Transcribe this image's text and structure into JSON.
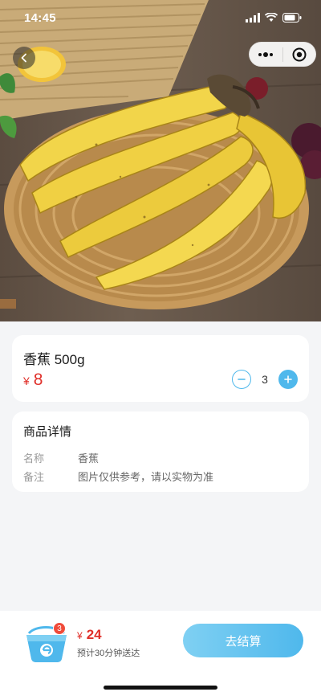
{
  "status_bar": {
    "time": "14:45"
  },
  "product": {
    "name": "香蕉 500g",
    "currency": "¥",
    "price": "8",
    "quantity": "3"
  },
  "detail": {
    "title": "商品详情",
    "rows": [
      {
        "key": "名称",
        "value": "香蕉"
      },
      {
        "key": "备注",
        "value": "图片仅供参考，请以实物为准"
      }
    ]
  },
  "bottom_bar": {
    "cart_badge": "3",
    "currency": "¥",
    "total": "24",
    "eta": "预计30分钟送达",
    "checkout_label": "去结算"
  },
  "colors": {
    "accent": "#4fb8ec",
    "price": "#e0302a",
    "badge": "#f04b3a"
  }
}
